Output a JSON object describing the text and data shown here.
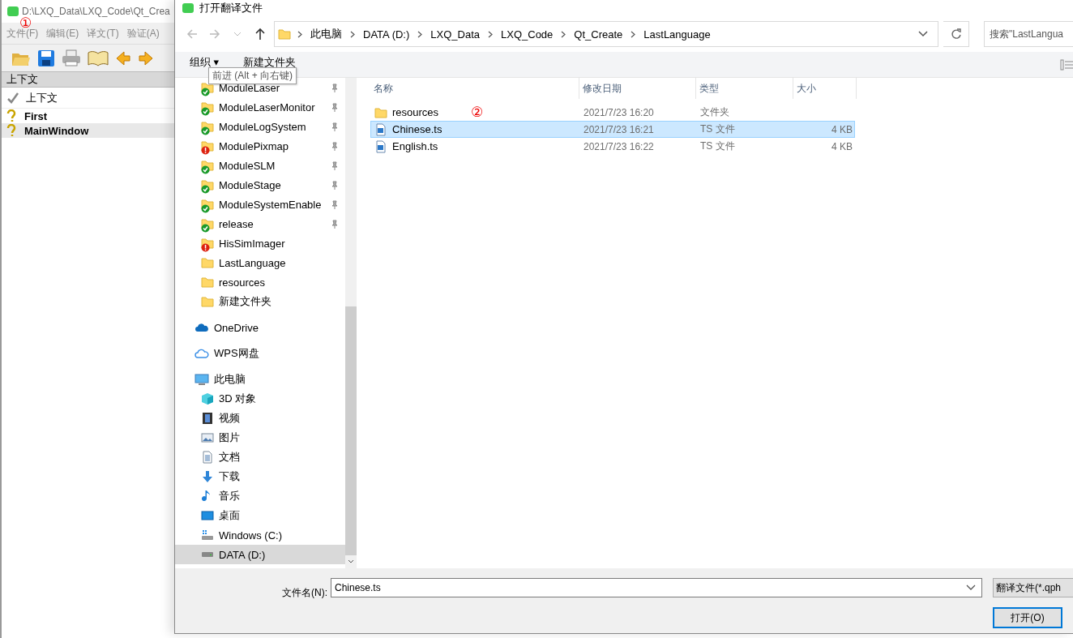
{
  "app": {
    "title": "D:\\LXQ_Data\\LXQ_Code\\Qt_Crea",
    "annotation": "①",
    "menu": [
      "文件(F)",
      "编辑(E)",
      "译文(T)",
      "验证(A)"
    ],
    "panel_title": "上下文",
    "table": {
      "header": "上下文",
      "rows": [
        {
          "label": "First",
          "selected": false
        },
        {
          "label": "MainWindow",
          "selected": true
        }
      ]
    }
  },
  "dialog": {
    "title": "打开翻译文件",
    "breadcrumbs": [
      "此电脑",
      "DATA (D:)",
      "LXQ_Data",
      "LXQ_Code",
      "Qt_Create",
      "LastLanguage"
    ],
    "search": {
      "placeholder": "搜索\"LastLangua"
    },
    "commands": [
      "组织 ▾",
      "新建文件夹"
    ],
    "tooltip": "前进 (Alt + 向右键)",
    "quick_access": [
      {
        "label": "ModuleLaser",
        "kind": "folder",
        "synced": true,
        "sync_error": false,
        "pinned": true,
        "selected": false
      },
      {
        "label": "ModuleLaserMonitor",
        "kind": "folder",
        "synced": true,
        "sync_error": false,
        "pinned": true,
        "selected": false
      },
      {
        "label": "ModuleLogSystem",
        "kind": "folder",
        "synced": true,
        "sync_error": false,
        "pinned": true,
        "selected": false
      },
      {
        "label": "ModulePixmap",
        "kind": "folder",
        "synced": false,
        "sync_error": true,
        "pinned": true,
        "selected": false
      },
      {
        "label": "ModuleSLM",
        "kind": "folder",
        "synced": true,
        "sync_error": false,
        "pinned": true,
        "selected": false
      },
      {
        "label": "ModuleStage",
        "kind": "folder",
        "synced": true,
        "sync_error": false,
        "pinned": true,
        "selected": false
      },
      {
        "label": "ModuleSystemEnable",
        "kind": "folder",
        "synced": true,
        "sync_error": false,
        "pinned": true,
        "selected": false
      },
      {
        "label": "release",
        "kind": "folder",
        "synced": true,
        "sync_error": false,
        "pinned": true,
        "selected": false
      },
      {
        "label": "HisSimImager",
        "kind": "folder",
        "synced": false,
        "sync_error": true,
        "pinned": false,
        "selected": false
      },
      {
        "label": "LastLanguage",
        "kind": "folder",
        "synced": false,
        "sync_error": false,
        "pinned": false,
        "selected": false
      },
      {
        "label": "resources",
        "kind": "folder",
        "synced": false,
        "sync_error": false,
        "pinned": false,
        "selected": false
      },
      {
        "label": "新建文件夹",
        "kind": "folder",
        "synced": false,
        "sync_error": false,
        "pinned": false,
        "selected": false
      }
    ],
    "locations": [
      {
        "label": "OneDrive",
        "kind": "cloud",
        "selected": false
      },
      {
        "label": "WPS网盘",
        "kind": "netdisk",
        "selected": false
      },
      {
        "label": "此电脑",
        "kind": "computer",
        "selected": false,
        "children": [
          {
            "label": "3D 对象",
            "kind": "cube",
            "selected": false
          },
          {
            "label": "视频",
            "kind": "video",
            "selected": false
          },
          {
            "label": "图片",
            "kind": "image",
            "selected": false
          },
          {
            "label": "文档",
            "kind": "document",
            "selected": false
          },
          {
            "label": "下载",
            "kind": "download",
            "selected": false
          },
          {
            "label": "音乐",
            "kind": "music",
            "selected": false
          },
          {
            "label": "桌面",
            "kind": "desktop",
            "selected": false
          },
          {
            "label": "Windows (C:)",
            "kind": "windrive",
            "selected": false
          },
          {
            "label": "DATA (D:)",
            "kind": "drive",
            "selected": true
          }
        ]
      }
    ],
    "columns": [
      "名称",
      "修改日期",
      "类型",
      "大小"
    ],
    "annotation": "②",
    "files": [
      {
        "name": "resources",
        "date": "2021/7/23 16:20",
        "type": "文件夹",
        "kind": "folder",
        "selected": false
      },
      {
        "name": "Chinese.ts",
        "date": "2021/7/23 16:21",
        "type": "TS 文件",
        "size": "4 KB",
        "kind": "ts",
        "selected": true
      },
      {
        "name": "English.ts",
        "date": "2021/7/23 16:22",
        "type": "TS 文件",
        "size": "4 KB",
        "kind": "ts",
        "selected": false
      }
    ],
    "filename_label": "文件名(N):",
    "filename": "Chinese.ts",
    "filetype": "翻译文件(*.qph",
    "open_button": "打开(O)"
  }
}
